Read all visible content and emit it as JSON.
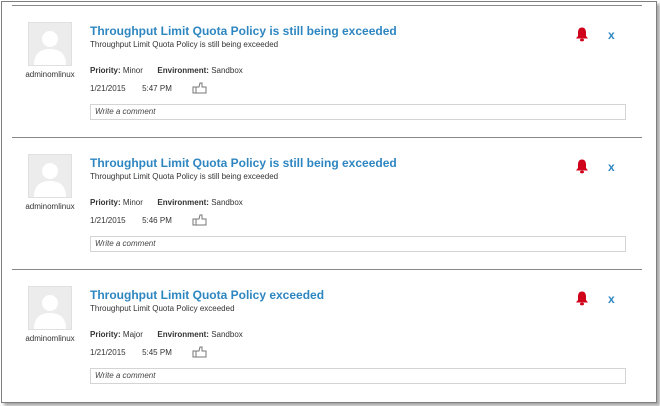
{
  "colors": {
    "title_blue": "#2e86c1",
    "bell_red": "#d0021b"
  },
  "alerts": [
    {
      "user": "adminomlinux",
      "title": "Throughput Limit Quota Policy is still being exceeded",
      "subtitle": "Throughput Limit Quota Policy is still being exceeded",
      "priority_label": "Priority:",
      "priority": "Minor",
      "environment_label": "Environment:",
      "environment": "Sandbox",
      "date": "1/21/2015",
      "time": "5:47 PM",
      "comment_placeholder": "Write a comment",
      "close_label": "x",
      "icons": [
        "bell-icon",
        "like-icon",
        "avatar-placeholder-icon"
      ]
    },
    {
      "user": "adminomlinux",
      "title": "Throughput Limit Quota Policy is still being exceeded",
      "subtitle": "Throughput Limit Quota Policy is still being exceeded",
      "priority_label": "Priority:",
      "priority": "Minor",
      "environment_label": "Environment:",
      "environment": "Sandbox",
      "date": "1/21/2015",
      "time": "5:46 PM",
      "comment_placeholder": "Write a comment",
      "close_label": "x",
      "icons": [
        "bell-icon",
        "like-icon",
        "avatar-placeholder-icon"
      ]
    },
    {
      "user": "adminomlinux",
      "title": "Throughput Limit Quota Policy exceeded",
      "subtitle": "Throughput Limit Quota Policy exceeded",
      "priority_label": "Priority:",
      "priority": "Major",
      "environment_label": "Environment:",
      "environment": "Sandbox",
      "date": "1/21/2015",
      "time": "5:45 PM",
      "comment_placeholder": "Write a comment",
      "close_label": "x",
      "icons": [
        "bell-icon",
        "like-icon",
        "avatar-placeholder-icon"
      ]
    }
  ]
}
